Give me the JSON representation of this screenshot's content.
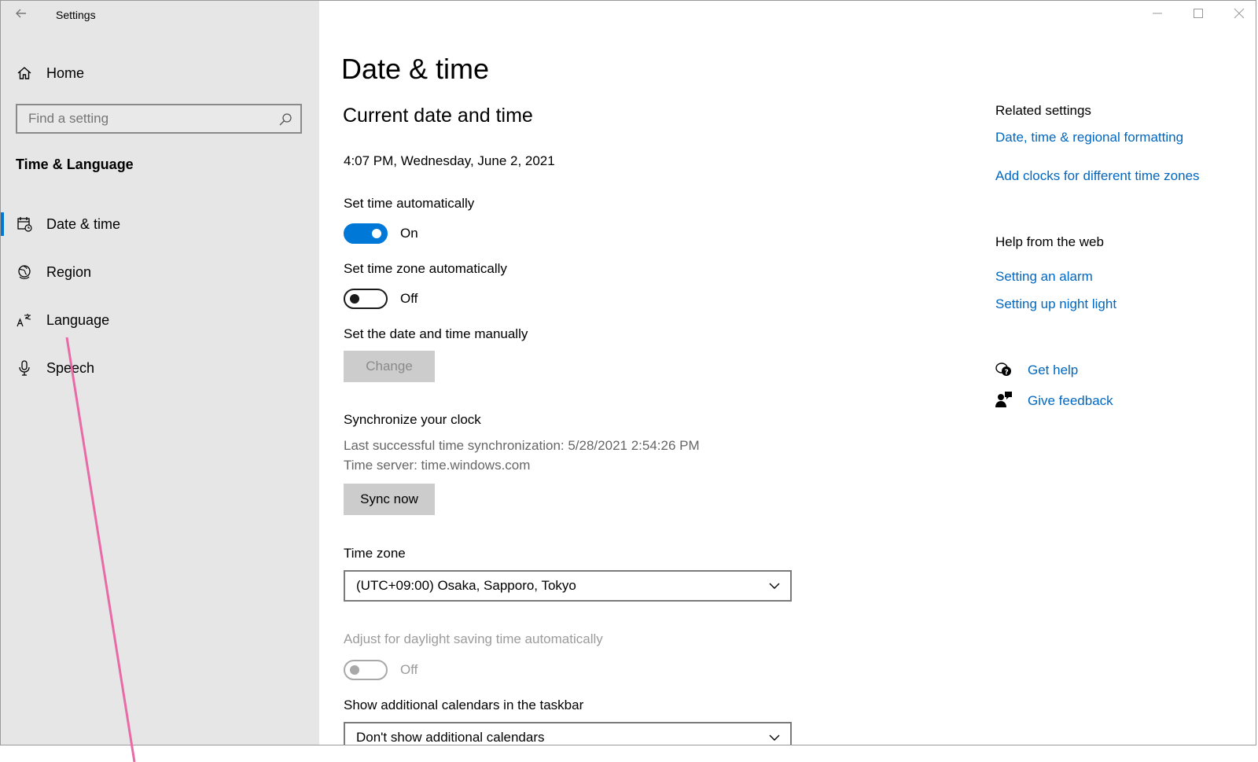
{
  "window": {
    "title": "Settings",
    "back_icon": "back-arrow-icon",
    "controls": [
      "minimize-icon",
      "maximize-icon",
      "close-icon"
    ]
  },
  "sidebar": {
    "home_label": "Home",
    "search_placeholder": "Find a setting",
    "section_title": "Time & Language",
    "items": [
      {
        "label": "Date & time",
        "icon": "calendar-clock-icon",
        "selected": true
      },
      {
        "label": "Region",
        "icon": "globe-icon",
        "selected": false
      },
      {
        "label": "Language",
        "icon": "language-icon",
        "selected": false
      },
      {
        "label": "Speech",
        "icon": "microphone-icon",
        "selected": false
      }
    ]
  },
  "main": {
    "page_title": "Date & time",
    "section_title": "Current date and time",
    "current_datetime": "4:07 PM, Wednesday, June 2, 2021",
    "set_time_auto": {
      "label": "Set time automatically",
      "state": "On"
    },
    "set_timezone_auto": {
      "label": "Set time zone automatically",
      "state": "Off"
    },
    "manual": {
      "label": "Set the date and time manually",
      "button": "Change"
    },
    "sync": {
      "title": "Synchronize your clock",
      "last_sync": "Last successful time synchronization: 5/28/2021 2:54:26 PM",
      "server": "Time server: time.windows.com",
      "button": "Sync now"
    },
    "timezone": {
      "label": "Time zone",
      "value": "(UTC+09:00) Osaka, Sapporo, Tokyo"
    },
    "dst": {
      "label": "Adjust for daylight saving time automatically",
      "state": "Off"
    },
    "calendars": {
      "label": "Show additional calendars in the taskbar",
      "value": "Don't show additional calendars"
    }
  },
  "related": {
    "title": "Related settings",
    "links": [
      "Date, time & regional formatting",
      "Add clocks for different time zones"
    ],
    "help_title": "Help from the web",
    "help_links": [
      "Setting an alarm",
      "Setting up night light"
    ],
    "get_help": "Get help",
    "give_feedback": "Give feedback"
  },
  "colors": {
    "accent": "#0078d7",
    "link": "#0067c0",
    "sidebar_bg": "#e6e6e6",
    "annotation_line": "#e86aa6"
  }
}
